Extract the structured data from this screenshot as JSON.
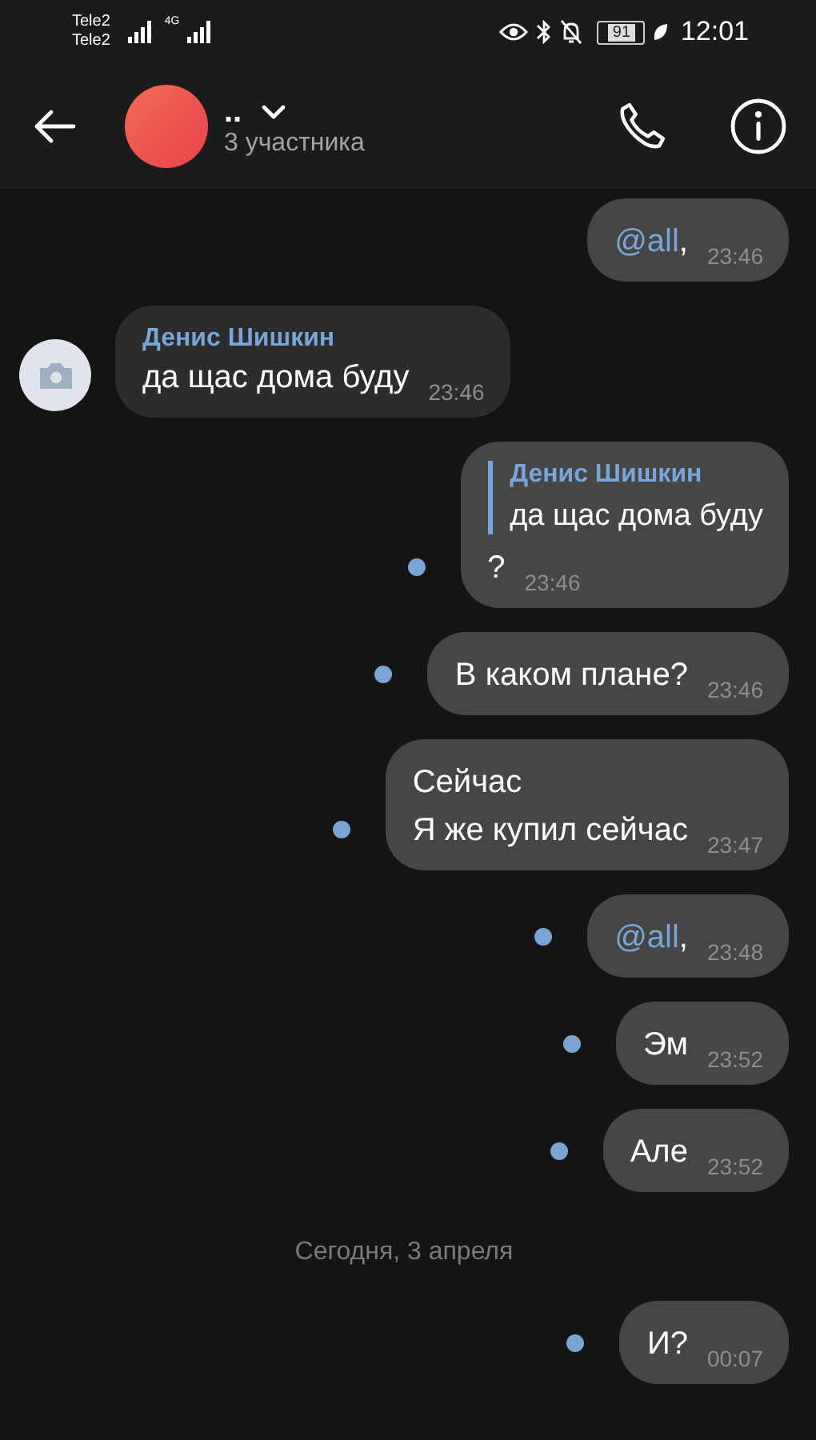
{
  "status_bar": {
    "carriers": [
      "Tele2",
      "Tele2"
    ],
    "network": "4G",
    "battery": "91",
    "time": "12:01"
  },
  "header": {
    "title": "..",
    "subtitle": "3 участника"
  },
  "messages": [
    {
      "kind": "outgoing",
      "mention": "@all",
      "text": ",",
      "time": "23:46",
      "unread": false
    },
    {
      "kind": "incoming",
      "author": "Денис Шишкин",
      "text": "да щас дома буду",
      "time": "23:46"
    },
    {
      "kind": "outgoing",
      "quote": {
        "author": "Денис Шишкин",
        "text": "да щас дома буду"
      },
      "text": "?",
      "time": "23:46",
      "unread": true
    },
    {
      "kind": "outgoing",
      "text": "В каком плане?",
      "time": "23:46",
      "unread": true
    },
    {
      "kind": "outgoing",
      "lines": [
        "Сейчас",
        "Я же купил сейчас"
      ],
      "time": "23:47",
      "unread": true
    },
    {
      "kind": "outgoing",
      "mention": "@all",
      "text": ",",
      "time": "23:48",
      "unread": true
    },
    {
      "kind": "outgoing",
      "text": "Эм",
      "time": "23:52",
      "unread": true
    },
    {
      "kind": "outgoing",
      "text": "Але",
      "time": "23:52",
      "unread": true
    },
    {
      "kind": "date",
      "text": "Сегодня, 3 апреля"
    },
    {
      "kind": "outgoing",
      "text": "И?",
      "time": "00:07",
      "unread": true
    }
  ]
}
